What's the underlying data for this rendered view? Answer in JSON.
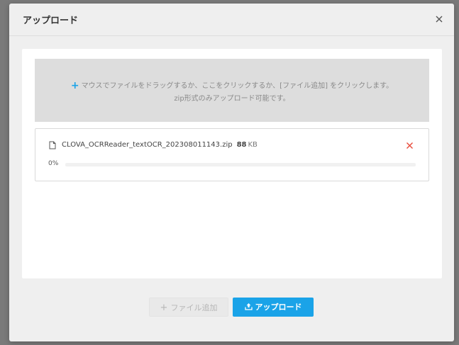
{
  "modal": {
    "title": "アップロード"
  },
  "dropzone": {
    "line1": "マウスでファイルをドラッグするか、ここをクリックするか、[ファイル追加] をクリックします。",
    "line2": "zip形式のみアップロード可能です。"
  },
  "file": {
    "name": "CLOVA_OCRReader_textOCR_202308011143.zip",
    "size_value": "88",
    "size_unit": "KB",
    "progress_label": "0%",
    "progress_fraction": 0.0
  },
  "footer": {
    "add_file_label": "ファイル追加",
    "upload_label": "アップロード"
  },
  "colors": {
    "accent": "#1aa3e8",
    "remove": "#e84a3a"
  },
  "icons": {
    "close": "close-icon",
    "plus": "plus-icon",
    "file": "file-icon",
    "remove": "remove-icon",
    "upload": "upload-icon"
  }
}
